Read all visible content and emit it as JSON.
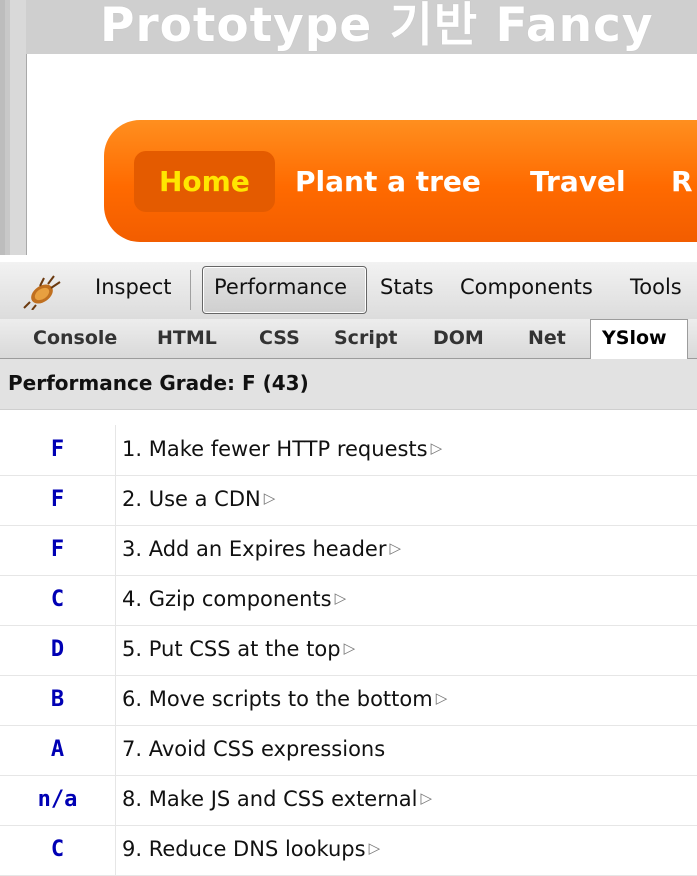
{
  "webpage": {
    "title": "Prototype 기반 Fancy",
    "nav": [
      "Home",
      "Plant a tree",
      "Travel",
      "R"
    ]
  },
  "toolbar": {
    "bug_icon": "firebug-icon",
    "items": [
      "Inspect",
      "Performance",
      "Stats",
      "Components",
      "Tools"
    ],
    "pressed": "Performance"
  },
  "tabs": {
    "items": [
      "Console",
      "HTML",
      "CSS",
      "Script",
      "DOM",
      "Net",
      "YSlow"
    ],
    "active": "YSlow"
  },
  "grade_header": "Performance Grade: F (43)",
  "rules": [
    {
      "grade": "F",
      "label": "1. Make fewer HTTP requests",
      "expand": true
    },
    {
      "grade": "F",
      "label": "2. Use a CDN",
      "expand": true
    },
    {
      "grade": "F",
      "label": "3. Add an Expires header",
      "expand": true
    },
    {
      "grade": "C",
      "label": "4. Gzip components",
      "expand": true
    },
    {
      "grade": "D",
      "label": "5. Put CSS at the top",
      "expand": true
    },
    {
      "grade": "B",
      "label": "6. Move scripts to the bottom",
      "expand": true
    },
    {
      "grade": "A",
      "label": "7. Avoid CSS expressions",
      "expand": false
    },
    {
      "grade": "n/a",
      "label": "8. Make JS and CSS external",
      "expand": true
    },
    {
      "grade": "C",
      "label": "9. Reduce DNS lookups",
      "expand": true
    }
  ],
  "colors": {
    "grade": "#0000b4",
    "nav_bg": "#ff6a00",
    "nav_active": "#ffe600"
  }
}
